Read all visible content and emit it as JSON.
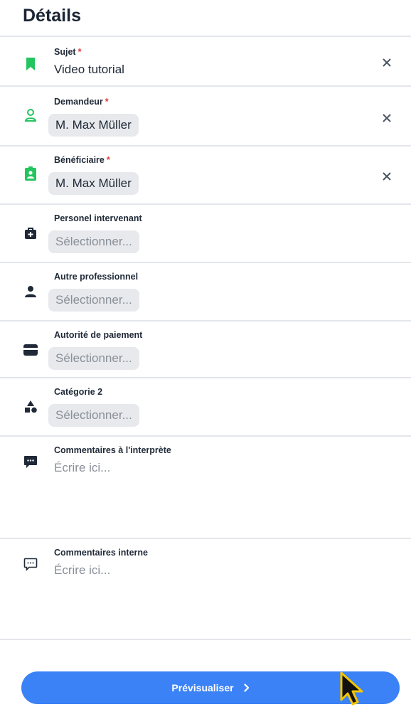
{
  "header": {
    "title": "Détails"
  },
  "fields": {
    "subject": {
      "label": "Sujet",
      "required_mark": "*",
      "value": "Video tutorial",
      "icon": "bookmark-icon",
      "icon_color": "#22c55e"
    },
    "requester": {
      "label": "Demandeur",
      "required_mark": "*",
      "value": "M. Max Müller",
      "icon": "user-outline-icon",
      "icon_color": "#22c55e"
    },
    "beneficiary": {
      "label": "Bénéficiaire",
      "required_mark": "*",
      "value": "M. Max Müller",
      "icon": "id-badge-icon",
      "icon_color": "#22c55e"
    },
    "staff": {
      "label": "Personel intervenant",
      "placeholder": "Sélectionner...",
      "icon": "medical-bag-icon"
    },
    "other_professional": {
      "label": "Autre professionnel",
      "placeholder": "Sélectionner...",
      "icon": "person-icon"
    },
    "payment_authority": {
      "label": "Autorité de paiement",
      "placeholder": "Sélectionner...",
      "icon": "credit-card-icon"
    },
    "category2": {
      "label": "Catégorie 2",
      "placeholder": "Sélectionner...",
      "icon": "shapes-icon"
    },
    "interpreter_comments": {
      "label": "Commentaires à l'interprète",
      "placeholder": "Écrire ici...",
      "icon": "chat-filled-icon"
    },
    "internal_comments": {
      "label": "Commentaires interne",
      "placeholder": "Écrire ici...",
      "icon": "chat-outline-icon"
    }
  },
  "actions": {
    "preview_label": "Prévisualiser"
  },
  "colors": {
    "accent": "#3b82f6",
    "required": "#e23b3b",
    "success_icon": "#22c55e"
  }
}
